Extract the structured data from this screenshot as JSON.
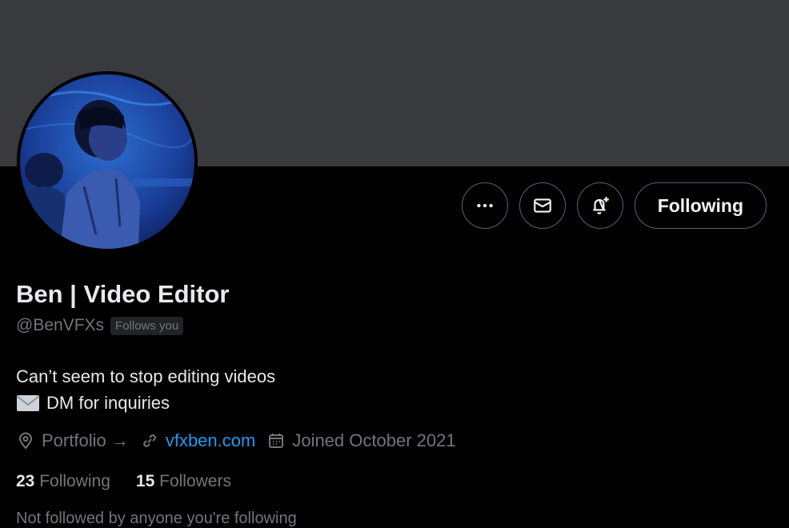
{
  "profile": {
    "display_name": "Ben | Video Editor",
    "handle": "@BenVFXs",
    "follows_you_badge": "Follows you",
    "bio_line1": "Can’t seem to stop editing videos",
    "bio_line2": "DM for inquiries",
    "bio_line2_icon": "envelope-emoji-icon",
    "location": "Portfolio →",
    "location_icon": "location-pin-icon",
    "website": "vfxben.com",
    "website_icon": "link-icon",
    "joined": "Joined October 2021",
    "joined_icon": "calendar-icon",
    "following_count": "23",
    "following_label": "Following",
    "followers_count": "15",
    "followers_label": "Followers",
    "followed_by_partial": "Not followed by anyone you're following"
  },
  "actions": {
    "more_icon": "more-icon",
    "message_icon": "mail-icon",
    "notify_icon": "bell-plus-icon",
    "following_button": "Following"
  },
  "colors": {
    "background": "#000000",
    "banner": "#383a3d",
    "text_primary": "#e7e9ea",
    "text_secondary": "#71767b",
    "link": "#1d9bf0",
    "border": "#536471"
  }
}
